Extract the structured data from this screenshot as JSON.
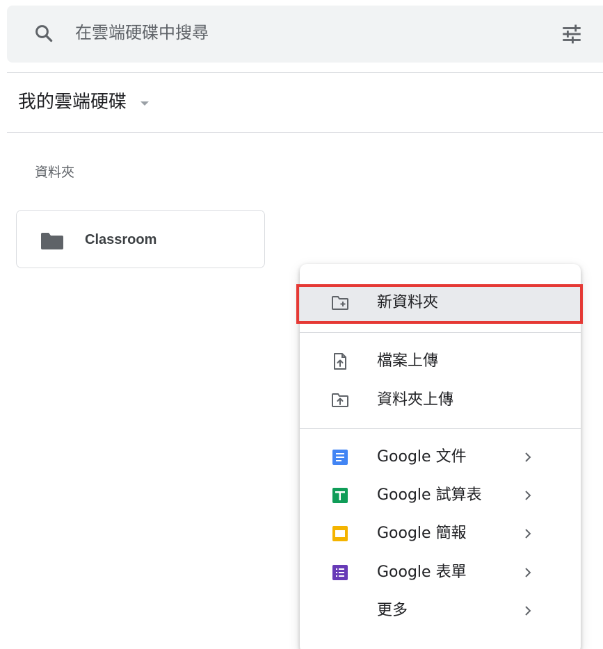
{
  "search": {
    "placeholder": "在雲端硬碟中搜尋",
    "icon": "search-icon",
    "options_icon": "tune-icon"
  },
  "header": {
    "title": "我的雲端硬碟",
    "caret_icon": "caret-down-icon"
  },
  "folders_section": {
    "label": "資料夾",
    "items": [
      {
        "name": "Classroom",
        "icon": "folder-icon"
      }
    ]
  },
  "new_menu": {
    "items": [
      {
        "label": "新資料夾",
        "icon": "new-folder-icon",
        "selected": true
      },
      {
        "label": "檔案上傳",
        "icon": "file-upload-icon"
      },
      {
        "label": "資料夾上傳",
        "icon": "folder-upload-icon"
      },
      {
        "label": "Google 文件",
        "icon": "google-docs-icon",
        "submenu": true
      },
      {
        "label": "Google 試算表",
        "icon": "google-sheets-icon",
        "submenu": true
      },
      {
        "label": "Google 簡報",
        "icon": "google-slides-icon",
        "submenu": true
      },
      {
        "label": "Google 表單",
        "icon": "google-forms-icon",
        "submenu": true
      },
      {
        "label": "更多",
        "icon": "",
        "submenu": true
      }
    ]
  },
  "colors": {
    "search_bg": "#f1f3f4",
    "selected_bg": "#e8eaed",
    "highlight": "#e53935",
    "docs": "#4285f4",
    "sheets": "#0f9d58",
    "slides": "#f4b400",
    "forms": "#673ab7",
    "icon_gray": "#5f6368"
  }
}
